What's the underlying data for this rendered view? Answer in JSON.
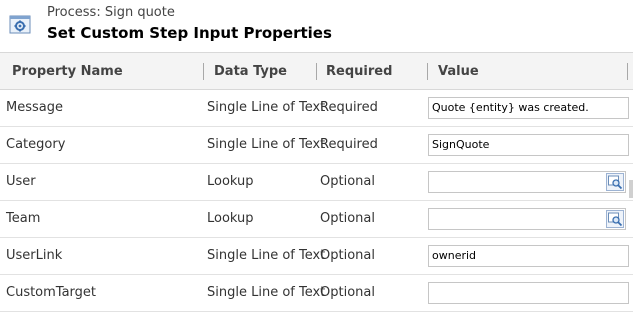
{
  "header": {
    "process_label": "Process: Sign quote",
    "title": "Set Custom Step Input Properties"
  },
  "columns": [
    "Property Name",
    "Data Type",
    "Required",
    "Value"
  ],
  "rows": [
    {
      "name": "Message",
      "type": "Single Line of Text",
      "required": "Required",
      "value": "Quote {entity} was created.",
      "lookup": false
    },
    {
      "name": "Category",
      "type": "Single Line of Text",
      "required": "Required",
      "value": "SignQuote",
      "lookup": false
    },
    {
      "name": "User",
      "type": "Lookup",
      "required": "Optional",
      "value": "",
      "lookup": true
    },
    {
      "name": "Team",
      "type": "Lookup",
      "required": "Optional",
      "value": "",
      "lookup": true
    },
    {
      "name": "UserLink",
      "type": "Single Line of Text",
      "required": "Optional",
      "value": "ownerid",
      "lookup": false
    },
    {
      "name": "CustomTarget",
      "type": "Single Line of Text",
      "required": "Optional",
      "value": "",
      "lookup": false
    }
  ],
  "icons": {
    "app": "process-gear-icon",
    "lookup": "lookup-search-icon"
  },
  "colors": {
    "header_bg": "#f4f4f4",
    "border": "#d8d8d8",
    "accent_blue": "#3a6fb0"
  }
}
